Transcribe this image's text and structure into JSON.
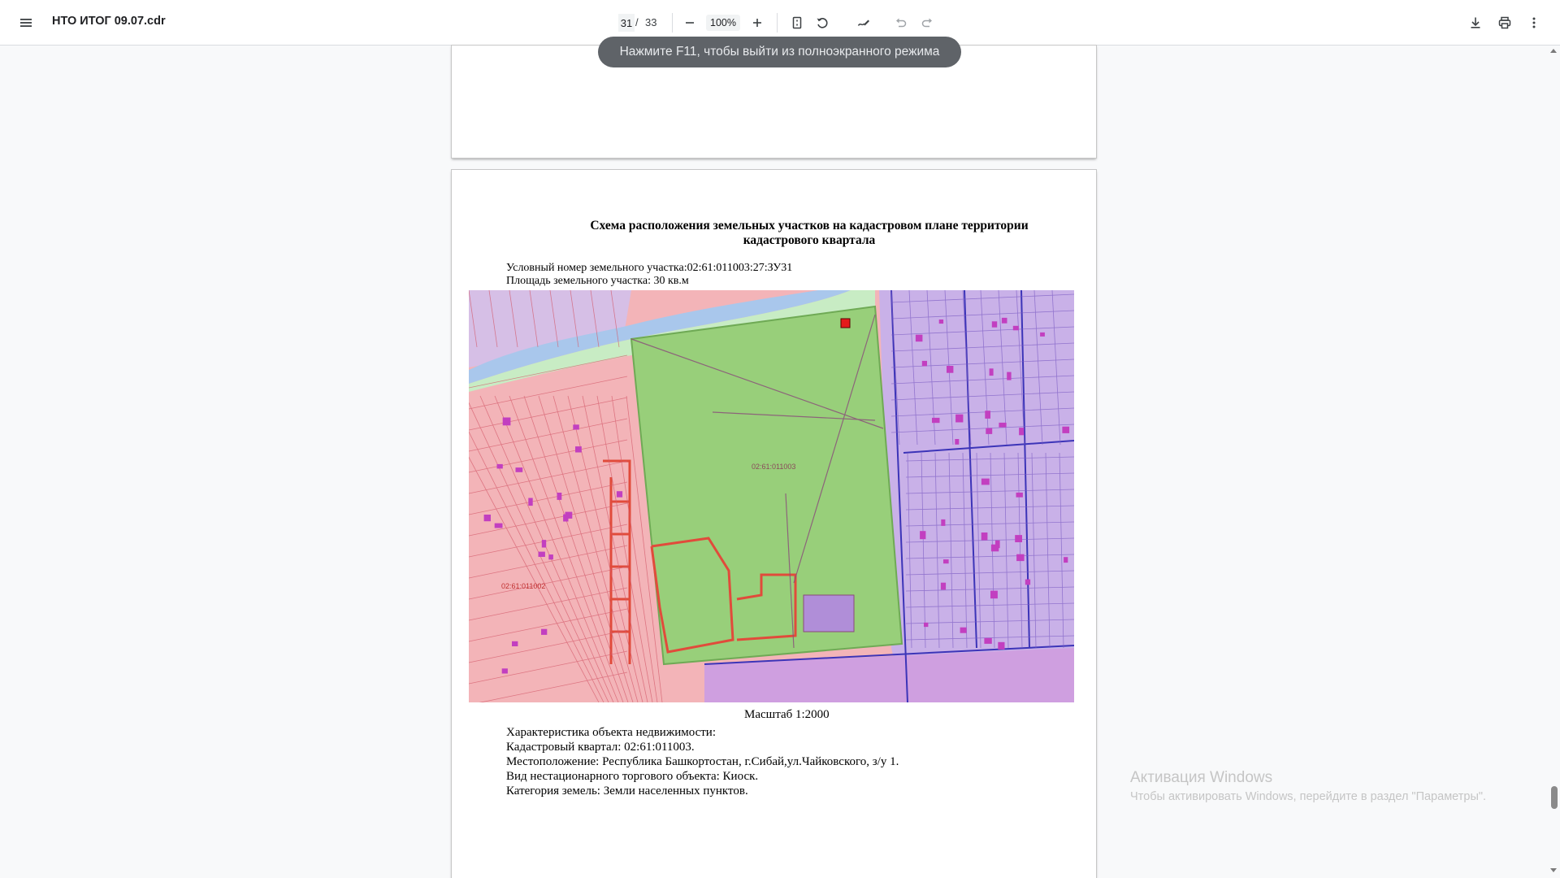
{
  "toolbar": {
    "menu_icon": "hamburger-menu-icon",
    "doc_title": "НТО ИТОГ 09.07.cdr",
    "current_page": "31",
    "page_separator": "/",
    "total_pages": "33",
    "zoom": "100%",
    "icons": [
      "zoom-out-icon",
      "zoom-in-icon",
      "fit-page-icon",
      "rotate-icon",
      "annotate-icon",
      "undo-icon",
      "redo-icon",
      "download-icon",
      "print-icon",
      "more-icon"
    ]
  },
  "toast": "Нажмите F11, чтобы выйти из полноэкранного режима",
  "page": {
    "title_line1": "Схема расположения земельных участков на кадастровом плане территории",
    "title_line2": "кадастрового квартала",
    "plot_number": "Условный номер земельного участка:02:61:011003:27:ЗУ31",
    "plot_area": "Площадь земельного участка: 30 кв.м",
    "map": {
      "label_center": "02:61:011003",
      "label_left": "02:61:011002",
      "colors": {
        "residential": "#f3b4b8",
        "park": "#98cf7a",
        "commercial": "#c9b1e8",
        "water": "#a9c7ec",
        "plot_marker": "#e51b1b",
        "boundary_red": "#e14b3b",
        "boundary_blue": "#3c34b8",
        "building": "#c23fc0"
      }
    },
    "scale": "Масштаб 1:2000",
    "char_heading": "Характеристика объекта недвижимости:",
    "char_quarter": "Кадастровый квартал: 02:61:011003.",
    "char_location": "Местоположение: Республика Башкортостан, г.Сибай,ул.Чайковского, з/у 1.",
    "char_type": "Вид нестационарного торгового объекта: Киоск.",
    "char_category": "Категория земель: Земли населенных пунктов."
  },
  "watermark": {
    "title": "Активация Windows",
    "subtitle": "Чтобы активировать Windows, перейдите в раздел \"Параметры\"."
  }
}
